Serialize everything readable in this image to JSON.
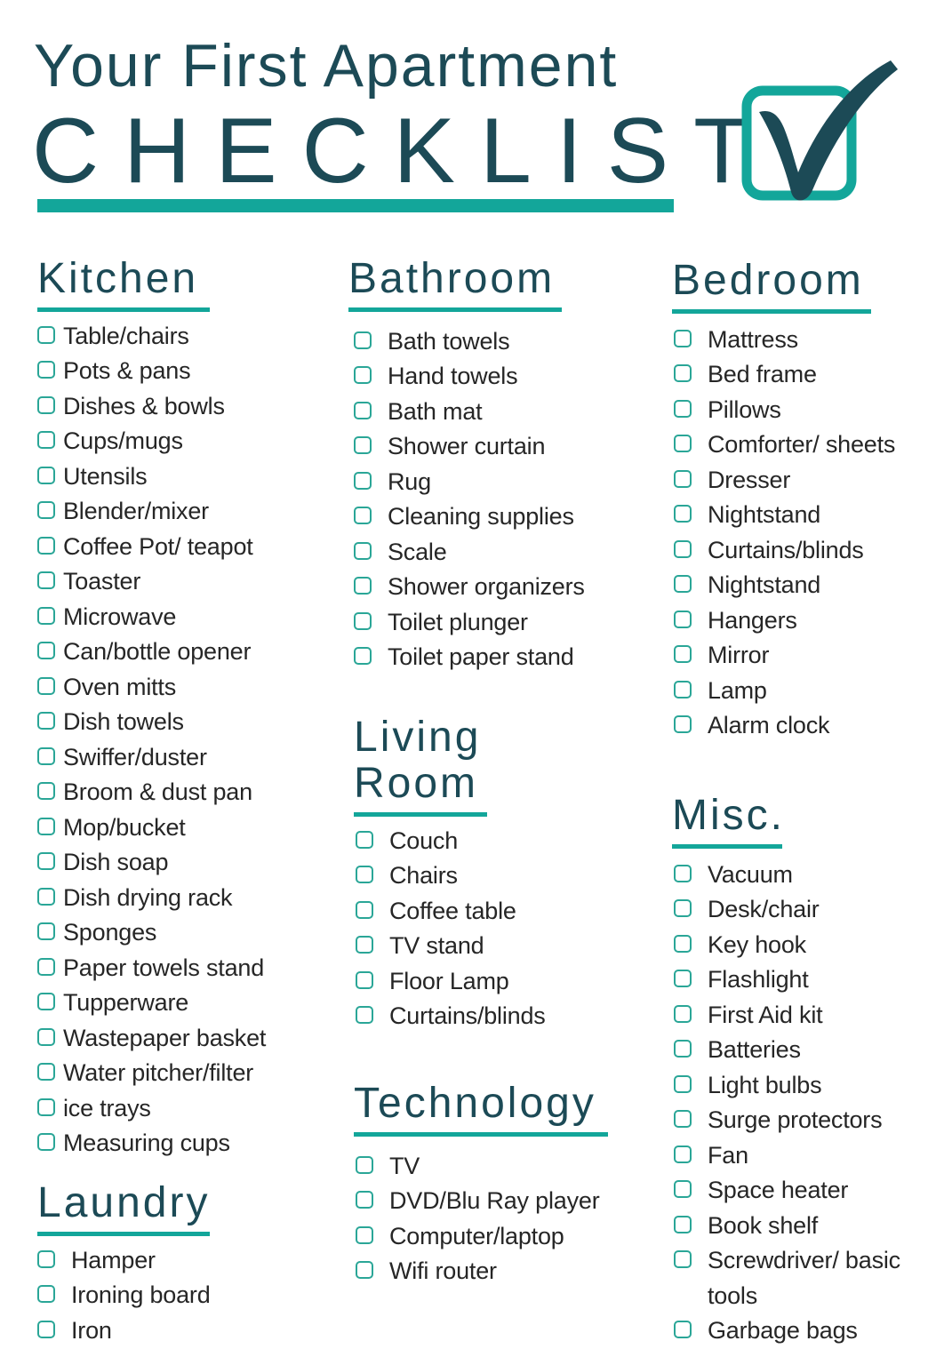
{
  "header": {
    "title_line1": "Your First Apartment",
    "title_line2": "CHECKLIST",
    "logo_icon": "checked-box-icon"
  },
  "colors": {
    "title": "#1c4a56",
    "accent": "#13a69a",
    "checkbox": "#2aa697",
    "text": "#262626"
  },
  "sections": {
    "kitchen": {
      "title": "Kitchen",
      "items": [
        "Table/chairs",
        "Pots & pans",
        "Dishes & bowls",
        "Cups/mugs",
        "Utensils",
        "Blender/mixer",
        "Coffee Pot/ teapot",
        "Toaster",
        "Microwave",
        "Can/bottle opener",
        "Oven mitts",
        "Dish towels",
        "Swiffer/duster",
        "Broom & dust pan",
        "Mop/bucket",
        "Dish soap",
        "Dish drying rack",
        "Sponges",
        "Paper towels stand",
        "Tupperware",
        "Wastepaper basket",
        "Water pitcher/filter",
        "ice trays",
        "Measuring cups"
      ]
    },
    "laundry": {
      "title": "Laundry",
      "items": [
        "Hamper",
        "Ironing board",
        "Iron"
      ]
    },
    "bathroom": {
      "title": "Bathroom",
      "items": [
        "Bath towels",
        "Hand towels",
        "Bath mat",
        "Shower curtain",
        "Rug",
        "Cleaning supplies",
        "Scale",
        "Shower organizers",
        "Toilet plunger",
        "Toilet paper stand"
      ]
    },
    "living_room": {
      "title": "Living\nRoom",
      "items": [
        "Couch",
        "Chairs",
        "Coffee table",
        "TV stand",
        "Floor Lamp",
        "Curtains/blinds"
      ]
    },
    "technology": {
      "title": "Technology",
      "items": [
        "TV",
        "DVD/Blu Ray player",
        "Computer/laptop",
        "Wifi router"
      ]
    },
    "bedroom": {
      "title": "Bedroom",
      "items": [
        "Mattress",
        "Bed frame",
        "Pillows",
        "Comforter/ sheets",
        "Dresser",
        "Nightstand",
        "Curtains/blinds",
        "Nightstand",
        "Hangers",
        "Mirror",
        "Lamp",
        "Alarm clock"
      ]
    },
    "misc": {
      "title": "Misc.",
      "items": [
        "Vacuum",
        "Desk/chair",
        "Key hook",
        "Flashlight",
        "First Aid kit",
        "Batteries",
        "Light bulbs",
        "Surge protectors",
        "Fan",
        "Space heater",
        "Book shelf",
        "Screwdriver/ basic\ntools",
        "Garbage bags"
      ]
    }
  }
}
